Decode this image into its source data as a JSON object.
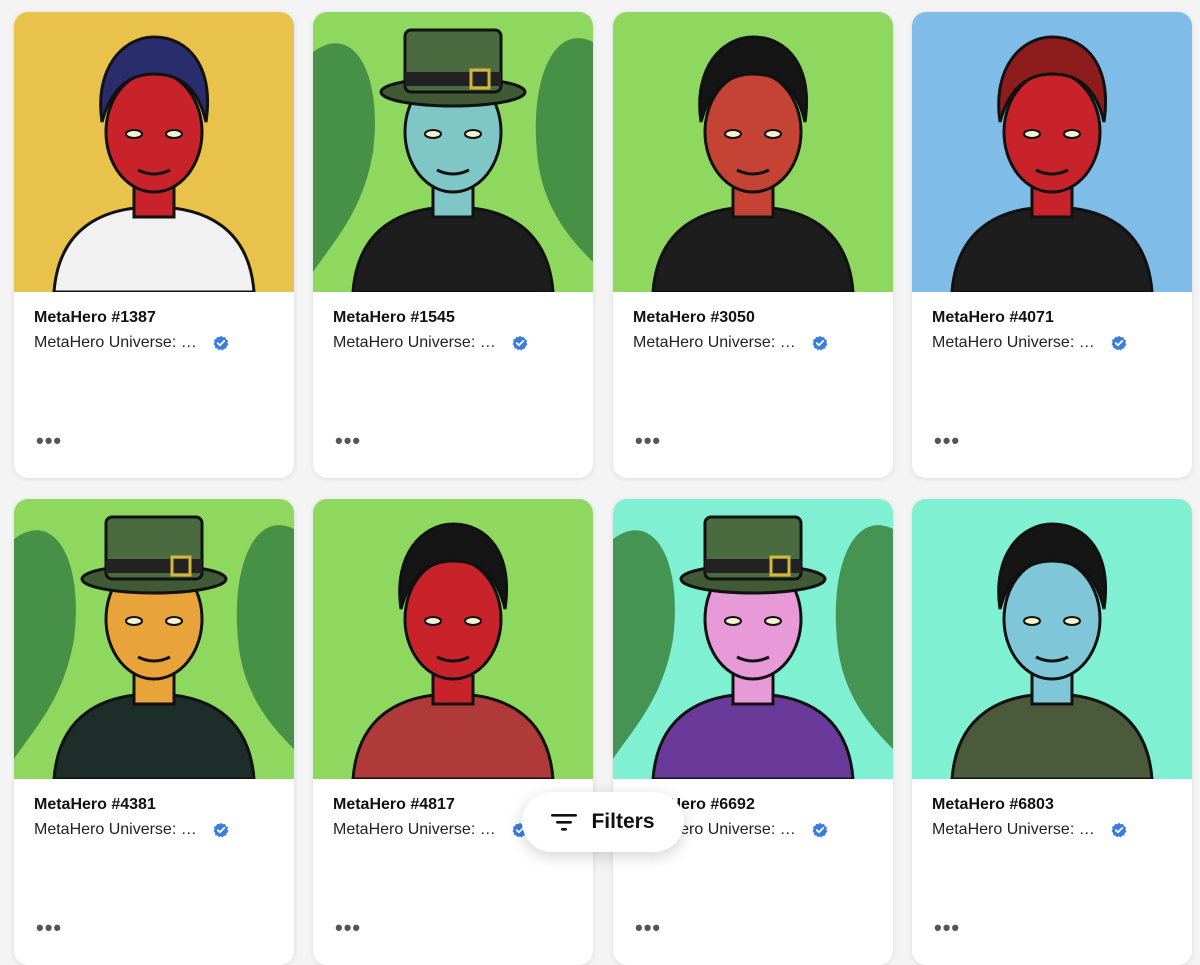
{
  "cards": [
    {
      "name": "MetaHero #1387",
      "collection": "MetaHero Universe: Generative Identities",
      "bg": "#e8c24a",
      "skin": "#c8232a",
      "hair": "#2a2d6b",
      "outfit": "#f1f1f1",
      "more_label": "•••"
    },
    {
      "name": "MetaHero #1545",
      "collection": "MetaHero Universe: Generative Identities",
      "bg": "#8fd85f",
      "skin": "#7fc7c7",
      "hair": "#4a5e3a",
      "outfit": "#1d1d1d",
      "more_label": "•••"
    },
    {
      "name": "MetaHero #3050",
      "collection": "MetaHero Universe: Generative Identities",
      "bg": "#8fd85f",
      "skin": "#c54335",
      "hair": "#151515",
      "outfit": "#1d1d1d",
      "more_label": "•••"
    },
    {
      "name": "MetaHero #4071",
      "collection": "MetaHero Universe: Generative Identities",
      "bg": "#7fbce8",
      "skin": "#c8232a",
      "hair": "#8f1c1c",
      "outfit": "#1d1d1d",
      "more_label": "•••"
    },
    {
      "name": "MetaHero #4381",
      "collection": "MetaHero Universe: Generative Identities",
      "bg": "#8fd85f",
      "skin": "#e8a43a",
      "hair": "#4a5e3a",
      "outfit": "#1d2d2a",
      "more_label": "•••"
    },
    {
      "name": "MetaHero #4817",
      "collection": "MetaHero Universe: Generative Identities",
      "bg": "#8fd85f",
      "skin": "#c8232a",
      "hair": "#151515",
      "outfit": "#b03a3a",
      "more_label": "•••"
    },
    {
      "name": "MetaHero #6692",
      "collection": "MetaHero Universe: Generative Identities",
      "bg": "#7ff0d2",
      "skin": "#e89ad8",
      "hair": "#4a5e3a",
      "outfit": "#6a3a9a",
      "more_label": "•••"
    },
    {
      "name": "MetaHero #6803",
      "collection": "MetaHero Universe: Generative Identities",
      "bg": "#7ff0d2",
      "skin": "#7fc7d8",
      "hair": "#151515",
      "outfit": "#4a5a3a",
      "more_label": "•••"
    }
  ],
  "filters": {
    "label": "Filters",
    "icon": "filter-lines-icon"
  },
  "colors": {
    "verified": "#3b7ddd"
  }
}
